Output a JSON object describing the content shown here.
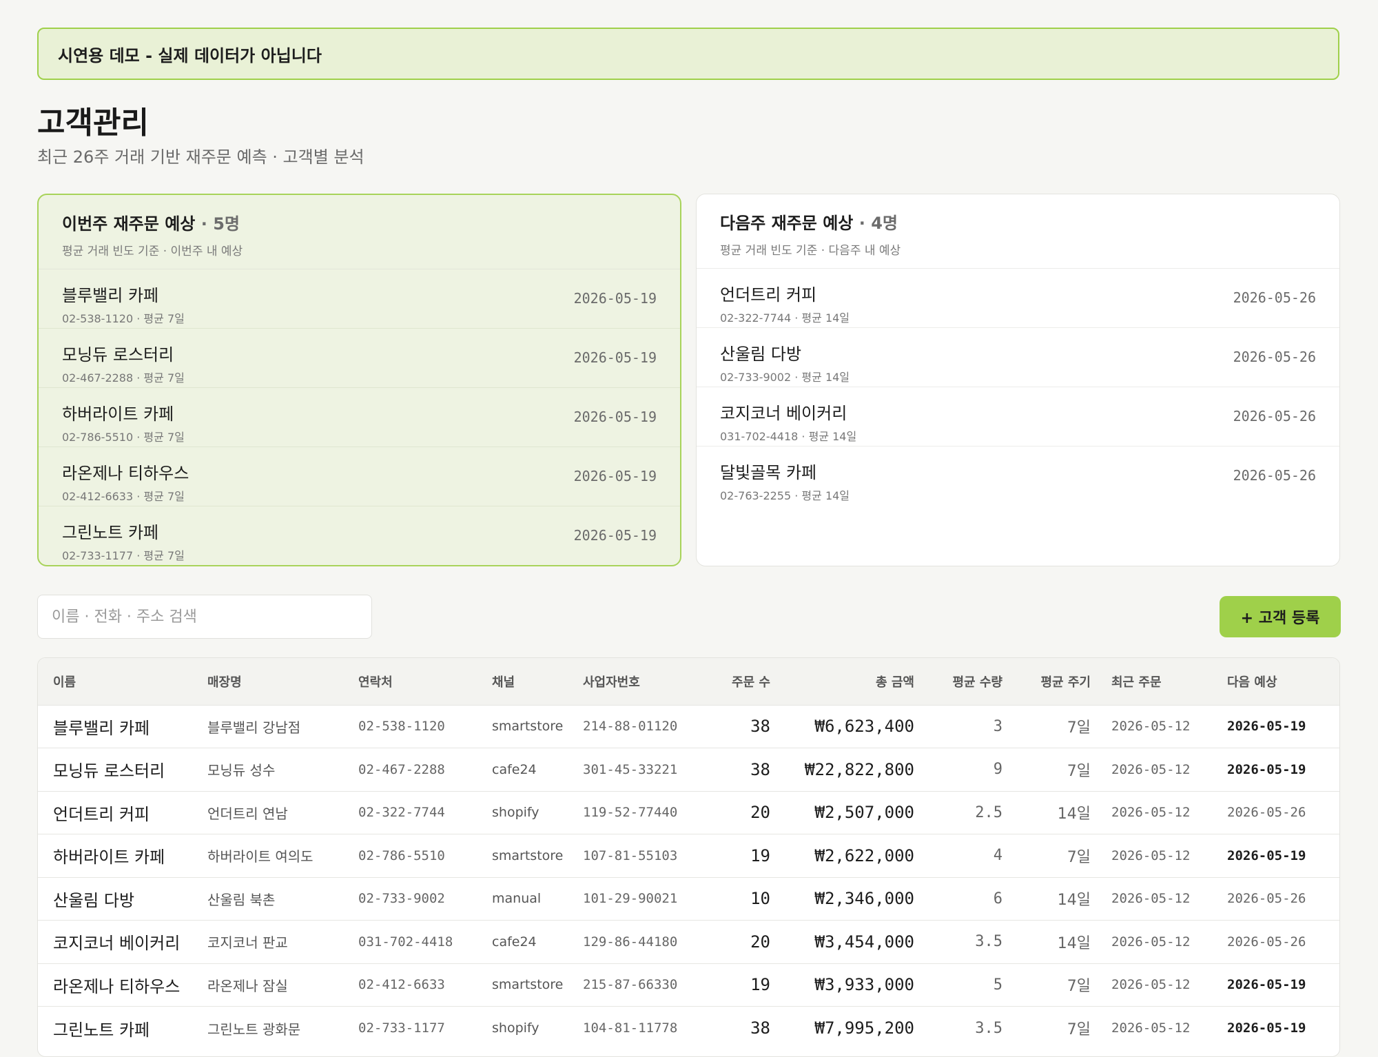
{
  "banner": "시연용 데모 - 실제 데이터가 아닙니다",
  "page": {
    "title": "고객관리",
    "subtitle": "최근 26주 거래 기반 재주문 예측 · 고객별 분석"
  },
  "this_week": {
    "title": "이번주 재주문 예상",
    "count": "· 5명",
    "subtitle": "평균 거래 빈도 기준 · 이번주 내 예상",
    "items": [
      {
        "name": "블루밸리 카페",
        "meta": "02-538-1120 · 평균 7일",
        "date": "2026-05-19"
      },
      {
        "name": "모닝듀 로스터리",
        "meta": "02-467-2288 · 평균 7일",
        "date": "2026-05-19"
      },
      {
        "name": "하버라이트 카페",
        "meta": "02-786-5510 · 평균 7일",
        "date": "2026-05-19"
      },
      {
        "name": "라온제나 티하우스",
        "meta": "02-412-6633 · 평균 7일",
        "date": "2026-05-19"
      },
      {
        "name": "그린노트 카페",
        "meta": "02-733-1177 · 평균 7일",
        "date": "2026-05-19"
      }
    ]
  },
  "next_week": {
    "title": "다음주 재주문 예상",
    "count": "· 4명",
    "subtitle": "평균 거래 빈도 기준 · 다음주 내 예상",
    "items": [
      {
        "name": "언더트리 커피",
        "meta": "02-322-7744 · 평균 14일",
        "date": "2026-05-26"
      },
      {
        "name": "산울림 다방",
        "meta": "02-733-9002 · 평균 14일",
        "date": "2026-05-26"
      },
      {
        "name": "코지코너 베이커리",
        "meta": "031-702-4418 · 평균 14일",
        "date": "2026-05-26"
      },
      {
        "name": "달빛골목 카페",
        "meta": "02-763-2255 · 평균 14일",
        "date": "2026-05-26"
      }
    ]
  },
  "search": {
    "placeholder": "이름 · 전화 · 주소 검색",
    "value": ""
  },
  "add_button": "+ 고객 등록",
  "table": {
    "headers": [
      "이름",
      "매장명",
      "연락처",
      "채널",
      "사업자번호",
      "주문 수",
      "총 금액",
      "평균 수량",
      "평균 주기",
      "최근 주문",
      "다음 예상"
    ],
    "rows": [
      {
        "name": "블루밸리 카페",
        "store": "블루밸리 강남점",
        "phone": "02-538-1120",
        "channel": "smartstore",
        "biz": "214-88-01120",
        "orders": "38",
        "amount": "₩6,623,400",
        "qty": "3",
        "cycle": "7일",
        "last": "2026-05-12",
        "next": "2026-05-19",
        "next_soon": true
      },
      {
        "name": "모닝듀 로스터리",
        "store": "모닝듀 성수",
        "phone": "02-467-2288",
        "channel": "cafe24",
        "biz": "301-45-33221",
        "orders": "38",
        "amount": "₩22,822,800",
        "qty": "9",
        "cycle": "7일",
        "last": "2026-05-12",
        "next": "2026-05-19",
        "next_soon": true
      },
      {
        "name": "언더트리 커피",
        "store": "언더트리 연남",
        "phone": "02-322-7744",
        "channel": "shopify",
        "biz": "119-52-77440",
        "orders": "20",
        "amount": "₩2,507,000",
        "qty": "2.5",
        "cycle": "14일",
        "last": "2026-05-12",
        "next": "2026-05-26",
        "next_soon": false
      },
      {
        "name": "하버라이트 카페",
        "store": "하버라이트 여의도",
        "phone": "02-786-5510",
        "channel": "smartstore",
        "biz": "107-81-55103",
        "orders": "19",
        "amount": "₩2,622,000",
        "qty": "4",
        "cycle": "7일",
        "last": "2026-05-12",
        "next": "2026-05-19",
        "next_soon": true
      },
      {
        "name": "산울림 다방",
        "store": "산울림 북촌",
        "phone": "02-733-9002",
        "channel": "manual",
        "biz": "101-29-90021",
        "orders": "10",
        "amount": "₩2,346,000",
        "qty": "6",
        "cycle": "14일",
        "last": "2026-05-12",
        "next": "2026-05-26",
        "next_soon": false
      },
      {
        "name": "코지코너 베이커리",
        "store": "코지코너 판교",
        "phone": "031-702-4418",
        "channel": "cafe24",
        "biz": "129-86-44180",
        "orders": "20",
        "amount": "₩3,454,000",
        "qty": "3.5",
        "cycle": "14일",
        "last": "2026-05-12",
        "next": "2026-05-26",
        "next_soon": false
      },
      {
        "name": "라온제나 티하우스",
        "store": "라온제나 잠실",
        "phone": "02-412-6633",
        "channel": "smartstore",
        "biz": "215-87-66330",
        "orders": "19",
        "amount": "₩3,933,000",
        "qty": "5",
        "cycle": "7일",
        "last": "2026-05-12",
        "next": "2026-05-19",
        "next_soon": true
      },
      {
        "name": "그린노트 카페",
        "store": "그린노트 광화문",
        "phone": "02-733-1177",
        "channel": "shopify",
        "biz": "104-81-11778",
        "orders": "38",
        "amount": "₩7,995,200",
        "qty": "3.5",
        "cycle": "7일",
        "last": "2026-05-12",
        "next": "2026-05-19",
        "next_soon": true
      }
    ]
  },
  "colors": {
    "accent": "#9fd04a",
    "accent_bg": "#e9f1d6",
    "card_this_bg": "#eef3e2"
  }
}
